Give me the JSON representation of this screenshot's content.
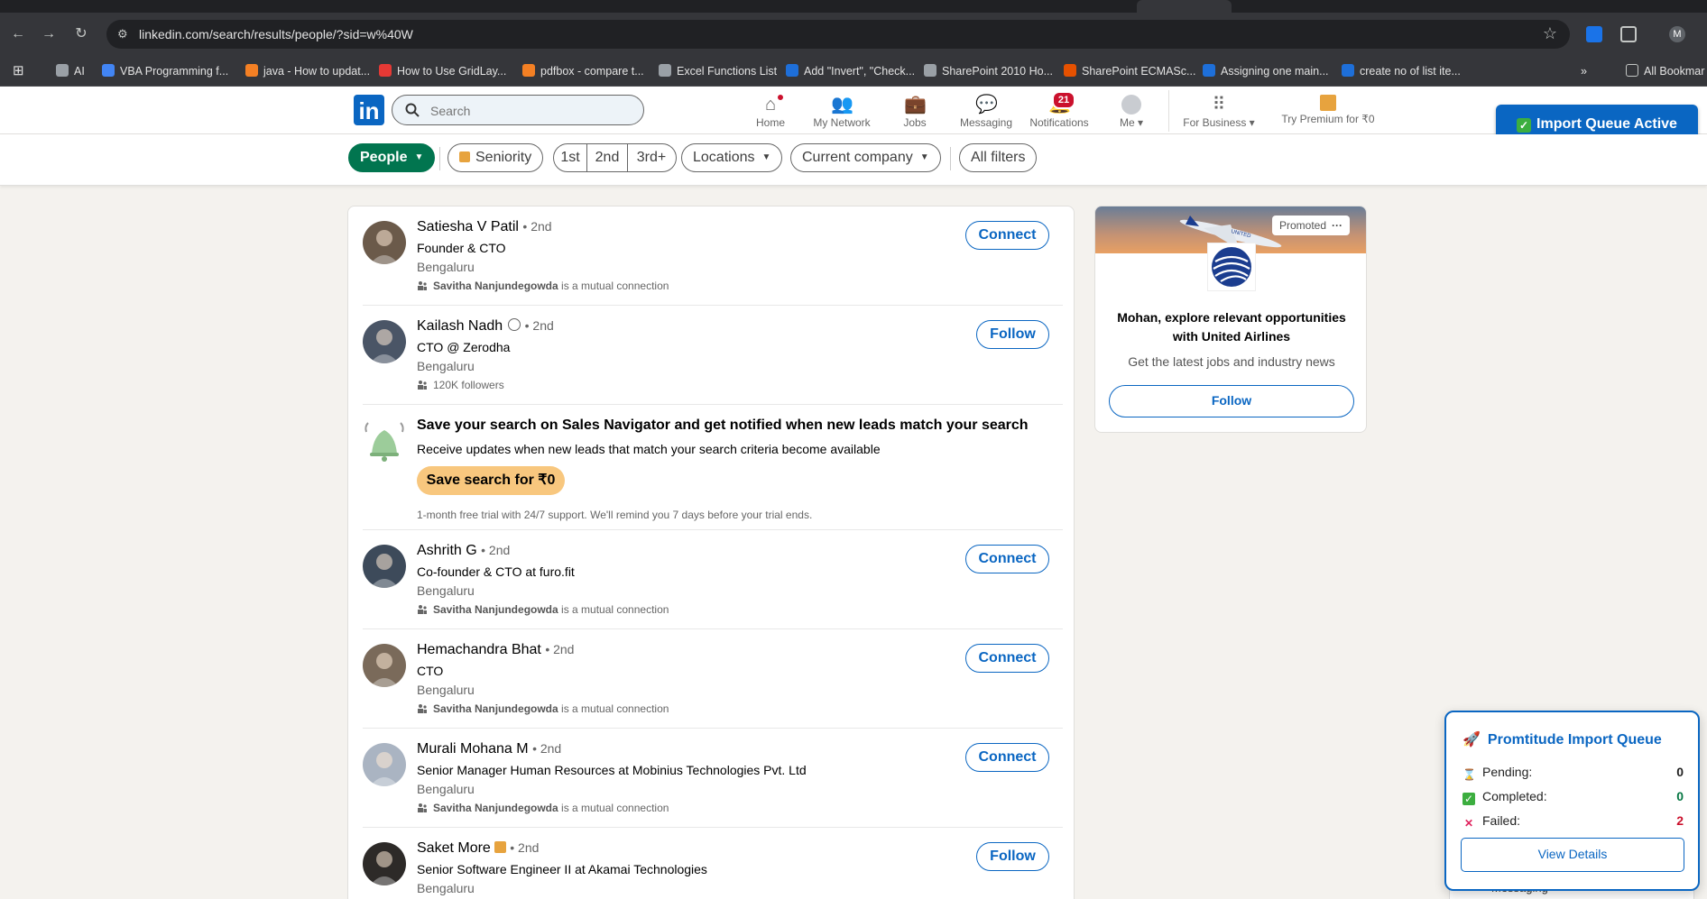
{
  "browser": {
    "url": "linkedin.com/search/results/people/?sid=w%40W",
    "profile_initial": "M",
    "bookmarks": [
      {
        "label": "AI",
        "color": "#9aa0a6"
      },
      {
        "label": "VBA Programming f...",
        "color": "#4285f4"
      },
      {
        "label": "java - How to updat...",
        "color": "#f48024"
      },
      {
        "label": "How to Use GridLay...",
        "color": "#e53935"
      },
      {
        "label": "pdfbox - compare t...",
        "color": "#f48024"
      },
      {
        "label": "Excel Functions List",
        "color": "#9aa0a6"
      },
      {
        "label": "Add \"Invert\", \"Check...",
        "color": "#1e6fd9"
      },
      {
        "label": "SharePoint 2010 Ho...",
        "color": "#9aa0a6"
      },
      {
        "label": "SharePoint ECMASc...",
        "color": "#e65100"
      },
      {
        "label": "Assigning one main...",
        "color": "#1e6fd9"
      },
      {
        "label": "create no of list ite...",
        "color": "#1e6fd9"
      }
    ],
    "all_bookmarks": "All Bookmar"
  },
  "nav": {
    "search_placeholder": "Search",
    "items": [
      {
        "label": "Home",
        "icon": "home-icon",
        "badge": ""
      },
      {
        "label": "My Network",
        "icon": "network-icon",
        "badge": ""
      },
      {
        "label": "Jobs",
        "icon": "jobs-icon",
        "badge": ""
      },
      {
        "label": "Messaging",
        "icon": "messaging-icon",
        "badge": ""
      },
      {
        "label": "Notifications",
        "icon": "bell-icon",
        "badge": "21"
      },
      {
        "label": "Me",
        "icon": "avatar",
        "badge": ""
      },
      {
        "label": "For Business",
        "icon": "grid-icon",
        "badge": ""
      },
      {
        "label": "Try Premium for ₹0",
        "icon": "premium-icon",
        "badge": ""
      }
    ],
    "import_active": "Import Queue Active"
  },
  "filters": {
    "people": "People",
    "seniority": "Seniority",
    "first": "1st",
    "second": "2nd",
    "third": "3rd+",
    "locations": "Locations",
    "company": "Current company",
    "all": "All filters"
  },
  "results": [
    {
      "name": "Satiesha V Patil",
      "degree": "• 2nd",
      "title": "Founder & CTO",
      "location": "Bengaluru",
      "mutual_name": "Savitha Nanjundegowda",
      "mutual_rest": " is a mutual connection",
      "action": "Connect"
    },
    {
      "name": "Kailash Nadh",
      "degree": "• 2nd",
      "title": "CTO @ Zerodha",
      "location": "Bengaluru",
      "mutual_name": "",
      "mutual_rest": "120K followers",
      "action": "Follow"
    },
    {
      "name": "Ashrith G",
      "degree": "• 2nd",
      "title": "Co-founder & CTO at furo.fit",
      "location": "Bengaluru",
      "mutual_name": "Savitha Nanjundegowda",
      "mutual_rest": " is a mutual connection",
      "action": "Connect"
    },
    {
      "name": "Hemachandra Bhat",
      "degree": "• 2nd",
      "title": "CTO",
      "location": "Bengaluru",
      "mutual_name": "Savitha Nanjundegowda",
      "mutual_rest": " is a mutual connection",
      "action": "Connect"
    },
    {
      "name": "Murali Mohana M",
      "degree": "• 2nd",
      "title": "Senior Manager Human Resources at Mobinius Technologies Pvt. Ltd",
      "location": "Bengaluru",
      "mutual_name": "Savitha Nanjundegowda",
      "mutual_rest": " is a mutual connection",
      "action": "Connect"
    },
    {
      "name": "Saket More",
      "degree": "• 2nd",
      "title": "Senior Software Engineer II at Akamai Technologies",
      "location": "Bengaluru",
      "mutual_name": "",
      "mutual_rest": "",
      "action": "Follow"
    }
  ],
  "sales_nav": {
    "title": "Save your search on Sales Navigator and get notified when new leads match your search",
    "subtitle": "Receive updates when new leads that match your search criteria become available",
    "button": "Save search for ₹0",
    "note": "1-month free trial with 24/7 support. We'll remind you 7 days before your trial ends."
  },
  "promo": {
    "tag": "Promoted",
    "headline": "Mohan, explore relevant opportunities with United Airlines",
    "sub": "Get the latest jobs and industry news",
    "button": "Follow"
  },
  "queue": {
    "title": "Promtitude Import Queue",
    "pending_label": "Pending:",
    "pending": "0",
    "completed_label": "Completed:",
    "completed": "0",
    "failed_label": "Failed:",
    "failed": "2",
    "button": "View Details"
  },
  "messaging": "Messaging",
  "colors": {
    "brand": "#0a66c2",
    "people_filter": "#01754f",
    "failed": "#cb112d",
    "completed": "#057642"
  }
}
